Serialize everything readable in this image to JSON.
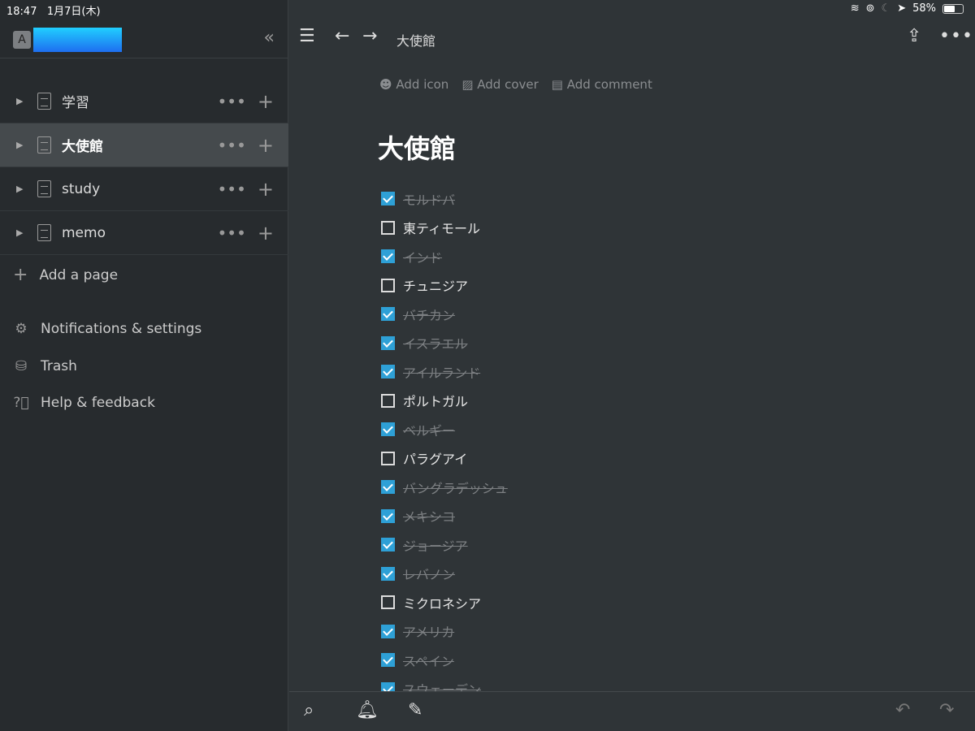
{
  "status": {
    "time": "18:47",
    "date": "1月7日(木)",
    "battery": "58%",
    "battery_level": 0.58
  },
  "sidebar": {
    "workspace_initial": "A",
    "pages": [
      {
        "label": "学習",
        "selected": false
      },
      {
        "label": "大使館",
        "selected": true
      },
      {
        "label": "study",
        "selected": false
      },
      {
        "label": "memo",
        "selected": false
      }
    ],
    "add_page": "Add a page",
    "menu": [
      {
        "label": "Notifications & settings",
        "icon": "gear-icon"
      },
      {
        "label": "Trash",
        "icon": "trash-icon"
      },
      {
        "label": "Help & feedback",
        "icon": "help-icon"
      }
    ]
  },
  "topbar": {
    "title": "大使館"
  },
  "page": {
    "add_icon": "Add icon",
    "add_cover": "Add cover",
    "add_comment": "Add comment",
    "title": "大使館",
    "todos": [
      {
        "text": "モルドバ",
        "done": true
      },
      {
        "text": "東ティモール",
        "done": false
      },
      {
        "text": "インド",
        "done": true
      },
      {
        "text": "チュニジア",
        "done": false
      },
      {
        "text": "バチカン",
        "done": true
      },
      {
        "text": "イスラエル",
        "done": true
      },
      {
        "text": "アイルランド",
        "done": true
      },
      {
        "text": "ポルトガル",
        "done": false
      },
      {
        "text": "ベルギー",
        "done": true
      },
      {
        "text": "パラグアイ",
        "done": false
      },
      {
        "text": "バングラデッシュ",
        "done": true
      },
      {
        "text": "メキシコ",
        "done": true
      },
      {
        "text": "ジョージア",
        "done": true
      },
      {
        "text": "レバノン",
        "done": true
      },
      {
        "text": "ミクロネシア",
        "done": false
      },
      {
        "text": "アメリカ",
        "done": true
      },
      {
        "text": "スペイン",
        "done": true
      },
      {
        "text": "スウェーデン",
        "done": true
      }
    ]
  },
  "colors": {
    "accent": "#2ea0d6",
    "sidebar_bg": "#272b2e",
    "main_bg": "#2f3437"
  }
}
